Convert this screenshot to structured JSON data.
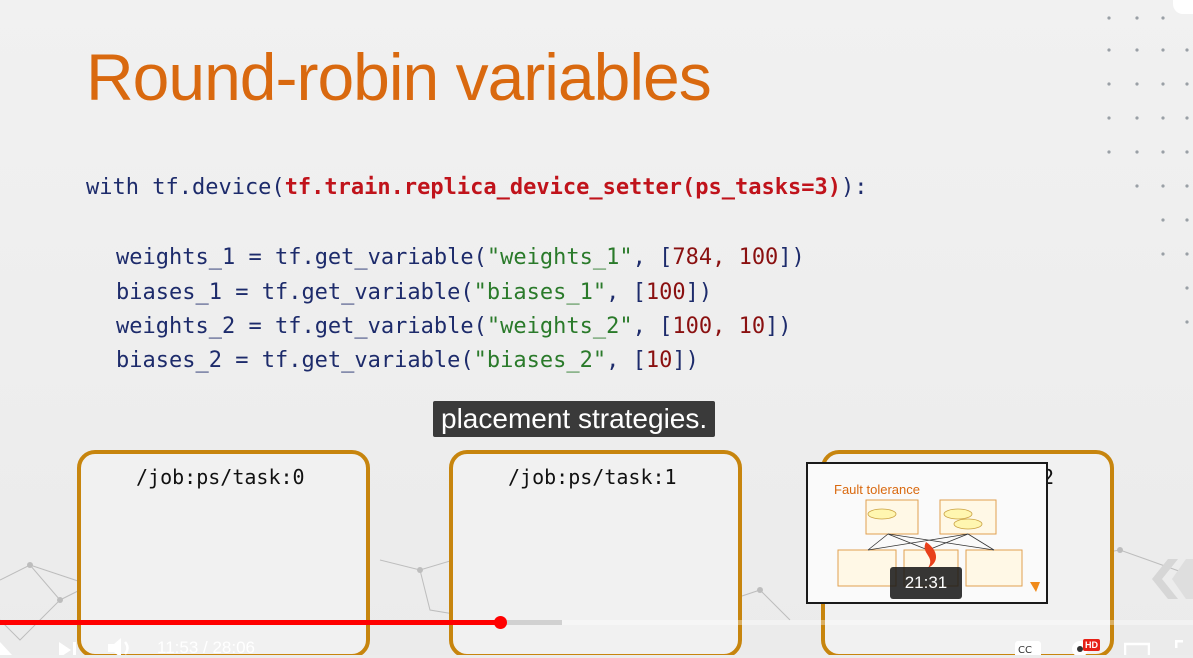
{
  "slide": {
    "title": "Round-robin variables",
    "code": {
      "with_prefix": "with tf.device(",
      "setter_call": "tf.train.replica_device_setter(ps_tasks=3)",
      "with_suffix": "):",
      "lines": [
        {
          "var": "weights_1",
          "mid": " = tf.get_variable(",
          "name": "\"weights_1\"",
          "sep": ", [",
          "shape": "784, 100",
          "end": "])"
        },
        {
          "var": "biases_1",
          "mid": " = tf.get_variable(",
          "name": "\"biases_1\"",
          "sep": ", [",
          "shape": "100",
          "end": "])"
        },
        {
          "var": "weights_2",
          "mid": " = tf.get_variable(",
          "name": "\"weights_2\"",
          "sep": ", [",
          "shape": "100, 10",
          "end": "])"
        },
        {
          "var": "biases_2",
          "mid": " = tf.get_variable(",
          "name": "\"biases_2\"",
          "sep": ", [",
          "shape": "10",
          "end": "])"
        }
      ]
    },
    "boxes": [
      {
        "label": "/job:ps/task:0"
      },
      {
        "label": "/job:ps/task:1"
      },
      {
        "label": "2"
      }
    ]
  },
  "player": {
    "caption": "placement strategies.",
    "preview": {
      "title": "Fault tolerance",
      "time": "21:31"
    },
    "time_display": "11:53 / 28:06",
    "progress": {
      "played_fraction": 0.419,
      "buffered_fraction": 0.471
    },
    "quality_badge": "HD",
    "colors": {
      "accent": "#ff0000",
      "title": "#d9690f",
      "box_border": "#c7850e"
    },
    "icons": [
      "next-icon",
      "volume-icon",
      "captions-icon",
      "settings-icon",
      "miniplayer-icon",
      "fullscreen-icon"
    ]
  }
}
